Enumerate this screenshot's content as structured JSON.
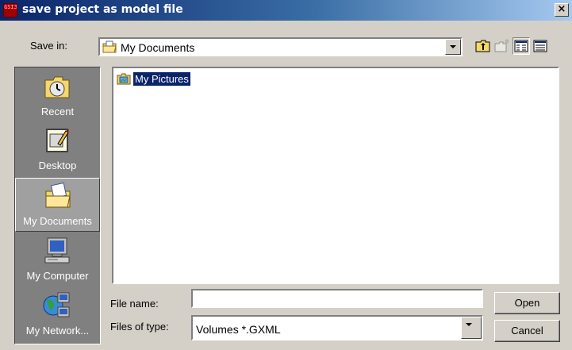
{
  "window": {
    "title": "save project as model file",
    "icon_text": "GSI3D",
    "close_label": "×"
  },
  "toolbar": {
    "save_in_label": "Save in:",
    "save_in_value": "My Documents",
    "buttons": [
      "up-one-level-icon",
      "create-new-folder-icon",
      "list-view-icon",
      "details-view-icon"
    ]
  },
  "places": [
    {
      "label": "Recent",
      "icon": "recent-icon",
      "selected": false
    },
    {
      "label": "Desktop",
      "icon": "desktop-icon",
      "selected": false
    },
    {
      "label": "My Documents",
      "icon": "my-documents-icon",
      "selected": true
    },
    {
      "label": "My Computer",
      "icon": "my-computer-icon",
      "selected": false
    },
    {
      "label": "My Network...",
      "icon": "my-network-icon",
      "selected": false
    }
  ],
  "files": [
    {
      "label": "My Pictures",
      "icon": "folder-icon",
      "selected": true
    }
  ],
  "form": {
    "file_name_label": "File name:",
    "file_name_value": "",
    "file_type_label": "Files of type:",
    "file_type_value": "Volumes *.GXML"
  },
  "buttons": {
    "open": "Open",
    "cancel": "Cancel"
  },
  "colors": {
    "title_start": "#0a246a",
    "title_end": "#a6caf0",
    "dialog_bg": "#d4d0c8",
    "places_bg": "#808080",
    "selection": "#0a246a"
  }
}
